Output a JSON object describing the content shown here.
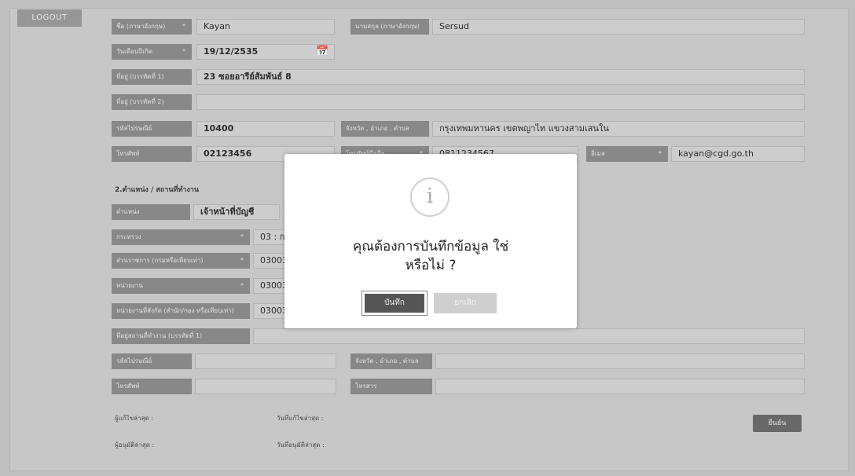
{
  "nav": {
    "logout_label": "LOGOUT"
  },
  "form": {
    "rows": [
      {
        "label": "ชื่อ (ภาษาอังกฤษ)",
        "required": "*",
        "value": "Kayan"
      },
      {
        "label": "นามสกุล (ภาษาอังกฤษ)",
        "required": "*",
        "value": "Sersud"
      },
      {
        "label": "วันเดือนปีเกิด",
        "required": "*",
        "value": "19/12/2535"
      },
      {
        "label": "ที่อยู่ (บรรทัดที่ 1)",
        "value": "23 ซอยอารีย์สัมพันธ์ 8"
      },
      {
        "label": "ที่อยู่ (บรรทัดที่ 2)",
        "value": ""
      },
      {
        "label": "รหัสไปรษณีย์",
        "value": "10400"
      },
      {
        "label": "จังหวัด , อำเภอ , ตำบล",
        "value": "กรุงเทพมหานคร เขตพญาไท แขวงสามเสนใน"
      },
      {
        "label": "โทรศัพท์",
        "value": "02123456"
      },
      {
        "label": "โทรศัพท์มือถือ",
        "required": "*",
        "value": "0811234567"
      },
      {
        "label": "อีเมล",
        "required": "*",
        "value": "kayan@cgd.go.th"
      }
    ],
    "section2_title": "2.ตำแหน่ง / สถานที่ทำงาน",
    "work": [
      {
        "label": "ตำแหน่ง",
        "value": "เจ้าหน้าที่บัญชี"
      },
      {
        "label": "กระทรวง",
        "required": "*",
        "value": "03 : กระทรวงการคลัง"
      },
      {
        "label": "ส่วนราชการ (กรมหรือเทียบเท่า)",
        "required": "*",
        "value": "03003"
      },
      {
        "label": "หน่วยงาน",
        "required": "*",
        "value": "0300300000"
      },
      {
        "label": "หน่วยงานที่สังกัด (สำนัก/กอง หรือเทียบเท่า)",
        "value": "0300300000"
      },
      {
        "label": "ที่อยู่สถานที่ทำงาน (บรรทัดที่ 1)",
        "value": ""
      }
    ],
    "bottom": [
      {
        "label": "รหัสไปรษณีย์",
        "value": ""
      },
      {
        "label": "จังหวัด , อำเภอ , ตำบล",
        "value": ""
      },
      {
        "label": "โทรศัพท์",
        "value": ""
      },
      {
        "label": "โทรสาร",
        "value": ""
      }
    ],
    "footer": {
      "modified_by": "ผู้แก้ไขล่าสุด :",
      "modified_date": "วันที่แก้ไขล่าสุด :",
      "approved_by": "ผู้อนุมัติล่าสุด :",
      "approved_date": "วันที่อนุมัติล่าสุด :",
      "submit_label": "ยืนยัน"
    }
  },
  "dialog": {
    "icon": "info-icon",
    "message_line1": "คุณต้องการบันทึกข้อมูล ใช่",
    "message_line2": "หรือไม่ ?",
    "confirm_label": "บันทึก",
    "cancel_label": "ยกเลิก"
  }
}
